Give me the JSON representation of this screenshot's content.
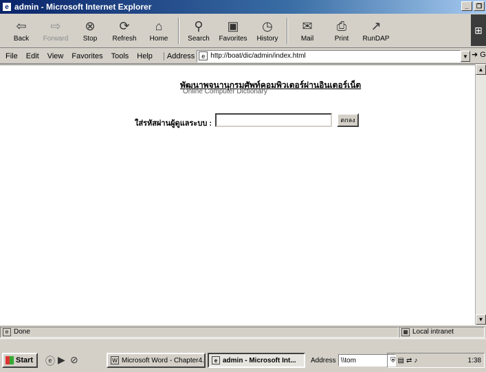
{
  "window": {
    "title": "admin - Microsoft Internet Explorer"
  },
  "toolbar": {
    "back": "Back",
    "forward": "Forward",
    "stop": "Stop",
    "refresh": "Refresh",
    "home": "Home",
    "search": "Search",
    "favorites": "Favorites",
    "history": "History",
    "mail": "Mail",
    "print": "Print",
    "rundap": "RunDAP"
  },
  "menu": {
    "file": "File",
    "edit": "Edit",
    "view": "View",
    "favorites": "Favorites",
    "tools": "Tools",
    "help": "Help",
    "address_label": "Address",
    "url": "http://boat/dic/admin/index.html",
    "go": "Go"
  },
  "page": {
    "heading_th": "พัฒนาพจนานุกรมศัพท์คอมพิวเตอร์ผ่านอินเตอร์เน็ต",
    "heading_en": "Online Computer Dictionary",
    "password_label": "ใส่รหัสผ่านผู้ดูแลระบบ :",
    "password_value": "",
    "submit_label": "ตกลง"
  },
  "status": {
    "left": "Done",
    "zone": "Local intranet"
  },
  "taskbar": {
    "start": "Start",
    "task1": "Microsoft Word - Chapter4...",
    "task2": "admin - Microsoft Int...",
    "address_label": "Address",
    "address_value": "\\\\tom",
    "clock": "1:38"
  }
}
